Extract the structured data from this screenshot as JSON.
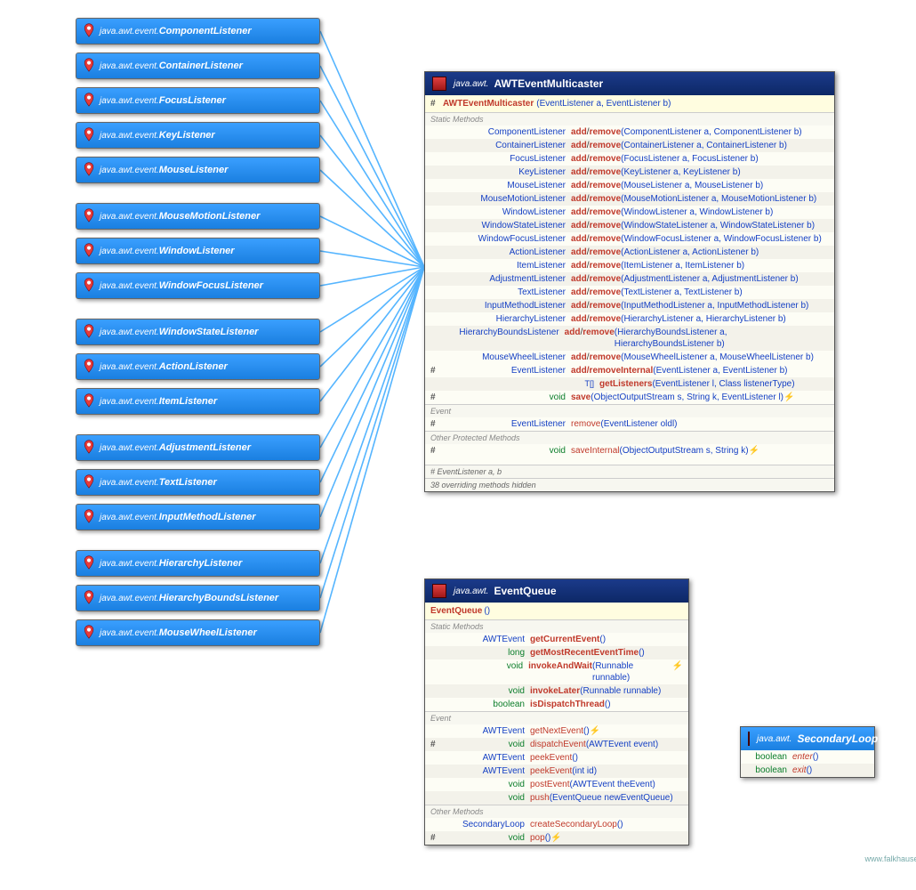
{
  "pkg_event": "java.awt.event.",
  "pkg_awt": "java.awt.",
  "listeners": [
    {
      "name": "ComponentListener",
      "gap": false
    },
    {
      "name": "ContainerListener",
      "gap": false
    },
    {
      "name": "FocusListener",
      "gap": false
    },
    {
      "name": "KeyListener",
      "gap": false
    },
    {
      "name": "MouseListener",
      "gap": true
    },
    {
      "name": "MouseMotionListener",
      "gap": false
    },
    {
      "name": "WindowListener",
      "gap": false
    },
    {
      "name": "WindowFocusListener",
      "gap": true
    },
    {
      "name": "WindowStateListener",
      "gap": false
    },
    {
      "name": "ActionListener",
      "gap": false
    },
    {
      "name": "ItemListener",
      "gap": true
    },
    {
      "name": "AdjustmentListener",
      "gap": false
    },
    {
      "name": "TextListener",
      "gap": false
    },
    {
      "name": "InputMethodListener",
      "gap": true
    },
    {
      "name": "HierarchyListener",
      "gap": false
    },
    {
      "name": "HierarchyBoundsListener",
      "gap": false
    },
    {
      "name": "MouseWheelListener",
      "gap": false
    }
  ],
  "multicaster": {
    "title": "AWTEventMulticaster",
    "ctor": {
      "name": "AWTEventMulticaster",
      "args": "(EventListener a, EventListener b)"
    },
    "static_label": "Static Methods",
    "static_rows": [
      {
        "ret": "ComponentListener",
        "args": "(ComponentListener a, ComponentListener b)"
      },
      {
        "ret": "ContainerListener",
        "args": "(ContainerListener a, ContainerListener b)"
      },
      {
        "ret": "FocusListener",
        "args": "(FocusListener a, FocusListener b)"
      },
      {
        "ret": "KeyListener",
        "args": "(KeyListener a, KeyListener b)"
      },
      {
        "ret": "MouseListener",
        "args": "(MouseListener a, MouseListener b)"
      },
      {
        "ret": "MouseMotionListener",
        "args": "(MouseMotionListener a, MouseMotionListener b)"
      },
      {
        "ret": "WindowListener",
        "args": "(WindowListener a, WindowListener b)"
      },
      {
        "ret": "WindowStateListener",
        "args": "(WindowStateListener a, WindowStateListener b)"
      },
      {
        "ret": "WindowFocusListener",
        "args": "(WindowFocusListener a, WindowFocusListener b)"
      },
      {
        "ret": "ActionListener",
        "args": "(ActionListener a, ActionListener b)"
      },
      {
        "ret": "ItemListener",
        "args": "(ItemListener a, ItemListener b)"
      },
      {
        "ret": "AdjustmentListener",
        "args": "(AdjustmentListener a, AdjustmentListener b)"
      },
      {
        "ret": "TextListener",
        "args": "(TextListener a, TextListener b)"
      },
      {
        "ret": "InputMethodListener",
        "args": "(InputMethodListener a, InputMethodListener b)"
      },
      {
        "ret": "HierarchyListener",
        "args": "(HierarchyListener a, HierarchyListener b)"
      },
      {
        "ret": "HierarchyBoundsListener",
        "args": "(HierarchyBoundsListener a, HierarchyBoundsListener b)"
      },
      {
        "ret": "MouseWheelListener",
        "args": "(MouseWheelListener a, MouseWheelListener b)"
      }
    ],
    "add_remove_label": "add/remove",
    "static_extra": [
      {
        "vis": "#",
        "ret": "EventListener",
        "name": "add/removeInternal",
        "args": "(EventListener a, EventListener b)"
      },
      {
        "vis": "",
        "ret": "<T extends EventListener> T[]",
        "name": "getListeners",
        "args": "(EventListener l, Class <T> listenerType)"
      },
      {
        "vis": "#",
        "ret": "void",
        "retkw": true,
        "name": "save",
        "args": "(ObjectOutputStream s, String k, EventListener l) ",
        "suffix": "⚡"
      }
    ],
    "event_label": "Event",
    "event_rows": [
      {
        "vis": "#",
        "ret": "EventListener",
        "name": "remove",
        "args": "(EventListener oldl)"
      }
    ],
    "other_label": "Other Protected Methods",
    "other_rows": [
      {
        "vis": "#",
        "ret": "void",
        "retkw": true,
        "name": "saveInternal",
        "args": "(ObjectOutputStream s, String k) ",
        "suffix": "⚡"
      }
    ],
    "fields": "# EventListener a, b",
    "hidden": "38 overriding methods hidden"
  },
  "eventqueue": {
    "title": "EventQueue",
    "ctor": {
      "name": "EventQueue",
      "args": "()"
    },
    "static_label": "Static Methods",
    "static_rows": [
      {
        "ret": "AWTEvent",
        "name": "getCurrentEvent",
        "args": "()"
      },
      {
        "ret": "long",
        "retkw": true,
        "name": "getMostRecentEventTime",
        "args": "()"
      },
      {
        "ret": "void",
        "retkw": true,
        "name": "invokeAndWait",
        "args": "(Runnable runnable) ",
        "suffix": "⚡"
      },
      {
        "ret": "void",
        "retkw": true,
        "name": "invokeLater",
        "args": "(Runnable runnable)"
      },
      {
        "ret": "boolean",
        "retkw": true,
        "name": "isDispatchThread",
        "args": "()"
      }
    ],
    "event_label": "Event",
    "event_rows": [
      {
        "vis": "",
        "ret": "AWTEvent",
        "name": "getNextEvent",
        "args": "() ",
        "suffix": "⚡"
      },
      {
        "vis": "#",
        "ret": "void",
        "retkw": true,
        "name": "dispatchEvent",
        "args": "(AWTEvent event)"
      },
      {
        "vis": "",
        "ret": "AWTEvent",
        "name": "peekEvent",
        "args": "()"
      },
      {
        "vis": "",
        "ret": "AWTEvent",
        "name": "peekEvent",
        "args": "(int id)"
      },
      {
        "vis": "",
        "ret": "void",
        "retkw": true,
        "name": "postEvent",
        "args": "(AWTEvent theEvent)"
      },
      {
        "vis": "",
        "ret": "void",
        "retkw": true,
        "name": "push",
        "args": "(EventQueue newEventQueue)"
      }
    ],
    "other_label": "Other Methods",
    "other_rows": [
      {
        "vis": "",
        "ret": "SecondaryLoop",
        "name": "createSecondaryLoop",
        "args": "()"
      },
      {
        "vis": "#",
        "ret": "void",
        "retkw": true,
        "name": "pop",
        "args": "() ",
        "suffix": "⚡"
      }
    ]
  },
  "secondaryloop": {
    "title": "SecondaryLoop",
    "rows": [
      {
        "ret": "boolean",
        "name": "enter",
        "args": "()",
        "italic": true
      },
      {
        "ret": "boolean",
        "name": "exit",
        "args": "()",
        "italic": true
      }
    ]
  },
  "credit": "www.falkhausen.de"
}
